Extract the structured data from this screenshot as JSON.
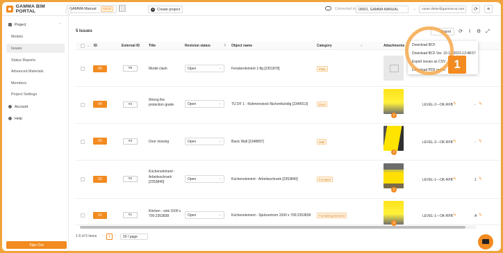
{
  "app": {
    "title": "GAMMA BIM PORTAL"
  },
  "header": {
    "project": "GAMMA Manual",
    "role_badge": "Admin",
    "create_project": "Create project",
    "connected_label": "Connected to",
    "server": "00001, GAMMA MANUAL",
    "user": "caner.dinler@gamma-ai.com"
  },
  "sidebar": {
    "section": "Project",
    "items": [
      {
        "label": "Models"
      },
      {
        "label": "Issues"
      },
      {
        "label": "Status Reports"
      },
      {
        "label": "Advanced Materials"
      },
      {
        "label": "Members"
      },
      {
        "label": "Project Settings"
      }
    ],
    "account": "Account",
    "help": "Help",
    "signout": "Sign Out"
  },
  "main": {
    "issues_count": "5 Issues",
    "export_label": "Export",
    "columns": {
      "id": "ID",
      "external_id": "External ID",
      "title": "Title",
      "revision_status": "Revision status",
      "object_name": "Object name",
      "category": "Category",
      "attachments": "Attachments"
    },
    "rows": [
      {
        "id": "05",
        "ext": "#5",
        "title": "Model clash",
        "status": "Open",
        "object": "Fensterelement 1-flg [2351878]",
        "category": "Plate",
        "att_count": "",
        "level": "",
        "extra": ""
      },
      {
        "id": "04",
        "ext": "#4",
        "title": "Wrong fire protection grade",
        "status": "Open",
        "object": "TÜ DF 1 - Rahmenstock flächenbündig [2349013]",
        "category": "Door",
        "att_count": "2",
        "level": "LEVEL-2---OK-RFB",
        "extra": "-"
      },
      {
        "id": "03",
        "ext": "#3",
        "title": "Door missing",
        "status": "Open",
        "object": "Basic Wall [2348897]",
        "category": "Wall",
        "att_count": "2",
        "level": "LEVEL-2---OK-RFB",
        "extra": "-"
      },
      {
        "id": "02",
        "ext": "#2",
        "title": "Küchenelement - Arbeitsschrank [2353840]",
        "status": "Open",
        "object": "Küchenelement - Arbeitsschrank [2353840]",
        "category": "Furniture",
        "att_count": "2",
        "level": "LEVEL-1---OK-RFB",
        "extra": "1"
      },
      {
        "id": "01",
        "ext": "#1",
        "title": "Kitchen - sink 1500 x 700:2353838",
        "status": "Open",
        "object": "Küchenelement - Spülzentrum 1500 x 700:2353838",
        "category": "Furnishing Element",
        "att_count": "3",
        "level": "LEVEL-1---OK-RFB",
        "extra": "A"
      }
    ],
    "pagination": {
      "range": "1-5 of 5 items",
      "page": "1",
      "page_size": "20 / page"
    }
  },
  "export_menu": {
    "items": [
      {
        "label": "Download BCF"
      },
      {
        "label": "Download BCF Ver. 10-12-2023-13:48:57"
      },
      {
        "label": "Export issues as CSV"
      },
      {
        "label": "Download PDF report"
      }
    ]
  },
  "annotation": {
    "step": "1"
  },
  "colors": {
    "accent": "#f28b20",
    "background": "#f0a33a"
  }
}
